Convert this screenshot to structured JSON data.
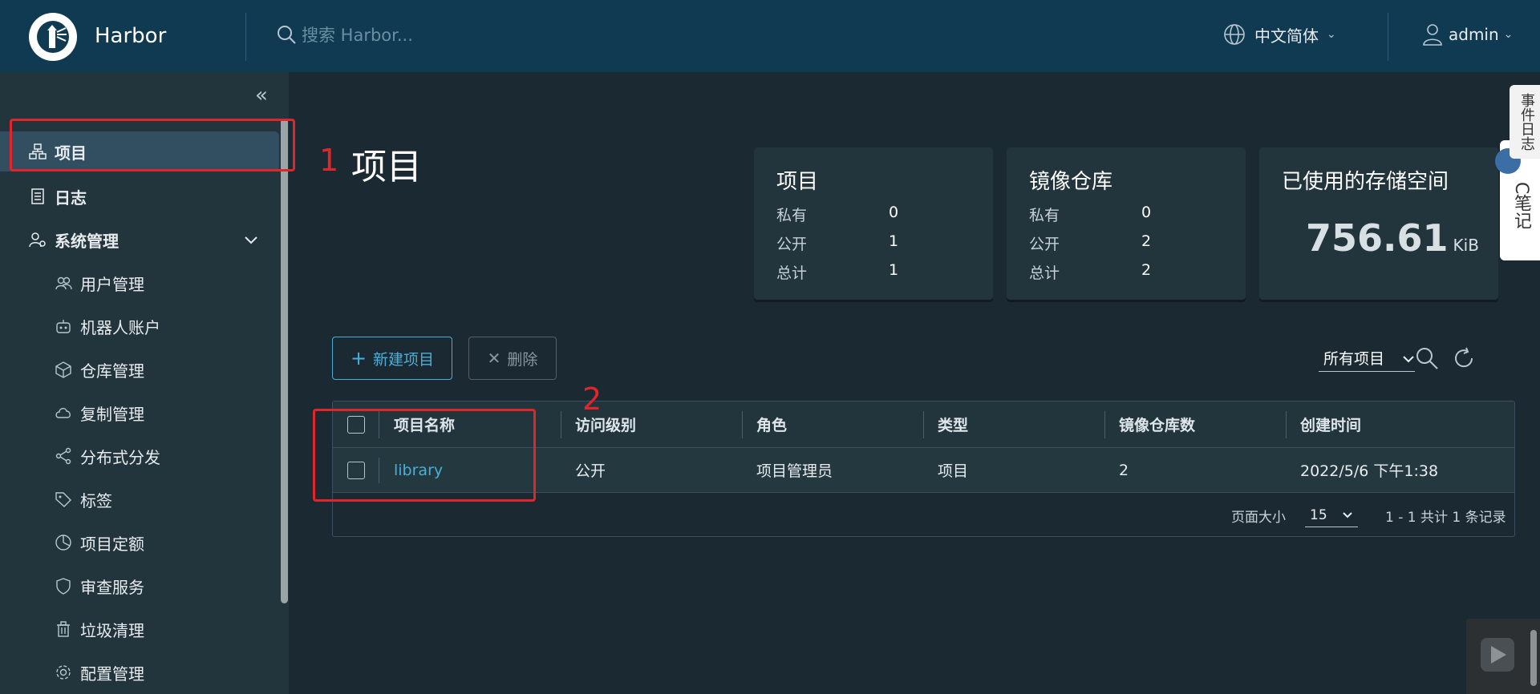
{
  "header": {
    "brand": "Harbor",
    "search_placeholder": "搜索 Harbor...",
    "language": "中文简体",
    "user": "admin"
  },
  "sidebar": {
    "items": [
      {
        "label": "项目",
        "icon": "projects-icon"
      },
      {
        "label": "日志",
        "icon": "logs-icon"
      },
      {
        "label": "系统管理",
        "icon": "system-admin-icon"
      },
      {
        "label": "用户管理",
        "icon": "users-icon"
      },
      {
        "label": "机器人账户",
        "icon": "robot-icon"
      },
      {
        "label": "仓库管理",
        "icon": "registry-icon"
      },
      {
        "label": "复制管理",
        "icon": "replication-icon"
      },
      {
        "label": "分布式分发",
        "icon": "distribution-icon"
      },
      {
        "label": "标签",
        "icon": "tag-icon"
      },
      {
        "label": "项目定额",
        "icon": "quota-icon"
      },
      {
        "label": "审查服务",
        "icon": "shield-icon"
      },
      {
        "label": "垃圾清理",
        "icon": "trash-icon"
      },
      {
        "label": "配置管理",
        "icon": "gear-icon"
      }
    ]
  },
  "annotations": {
    "label1": "1",
    "label2": "2"
  },
  "page": {
    "title": "项目"
  },
  "cards": {
    "projects": {
      "title": "项目",
      "rows": [
        {
          "label": "私有",
          "value": "0"
        },
        {
          "label": "公开",
          "value": "1"
        },
        {
          "label": "总计",
          "value": "1"
        }
      ]
    },
    "repos": {
      "title": "镜像仓库",
      "rows": [
        {
          "label": "私有",
          "value": "0"
        },
        {
          "label": "公开",
          "value": "2"
        },
        {
          "label": "总计",
          "value": "2"
        }
      ]
    },
    "storage": {
      "title": "已使用的存储空间",
      "value": "756.61",
      "unit": "KiB"
    }
  },
  "toolbar": {
    "new_project": "新建项目",
    "delete": "删除",
    "filter": "所有项目"
  },
  "table": {
    "columns": [
      "项目名称",
      "访问级别",
      "角色",
      "类型",
      "镜像仓库数",
      "创建时间"
    ],
    "rows": [
      {
        "name": "library",
        "access": "公开",
        "role": "项目管理员",
        "type": "项目",
        "repo_count": "2",
        "created": "2022/5/6 下午1:38"
      }
    ],
    "footer": {
      "page_size_label": "页面大小",
      "page_size": "15",
      "summary": "1 - 1 共计 1 条记录"
    }
  },
  "side_widgets": {
    "notes": "C笔记",
    "events": "事件日志"
  },
  "colors": {
    "header": "#0f3a52",
    "sidebar": "#22343c",
    "accent": "#49afd9",
    "annotation": "#e0262a"
  }
}
